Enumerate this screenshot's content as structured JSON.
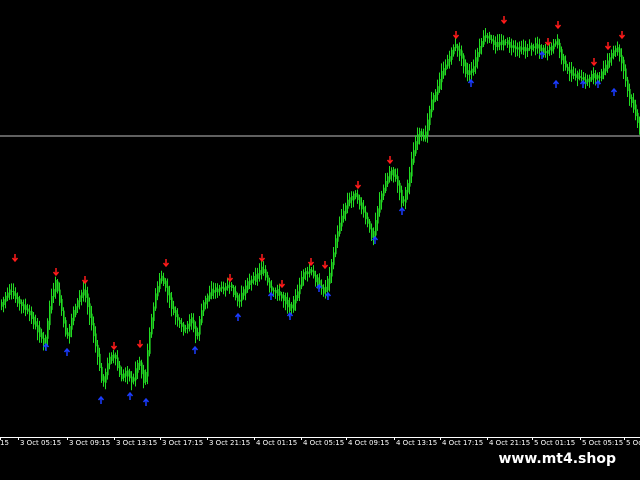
{
  "window": {
    "background": "#000000",
    "candle_color": "#22dd22",
    "wick_color": "#22dd22",
    "up_arrow_color": "#1a3cff",
    "down_arrow_color": "#ff1a1a",
    "hline_color": "#c0c0c0",
    "axis_color": "#ffffff"
  },
  "time_axis": {
    "labels": [
      "15",
      "3 Oct 05:15",
      "3 Oct 09:15",
      "3 Oct 13:15",
      "3 Oct 17:15",
      "3 Oct 21:15",
      "4 Oct 01:15",
      "4 Oct 05:15",
      "4 Oct 09:15",
      "4 Oct 13:15",
      "4 Oct 17:15",
      "4 Oct 21:15",
      "5 Oct 01:15",
      "5 Oct 05:15",
      "5 Oct"
    ]
  },
  "watermark": {
    "text": "www.mt4.shop"
  }
}
